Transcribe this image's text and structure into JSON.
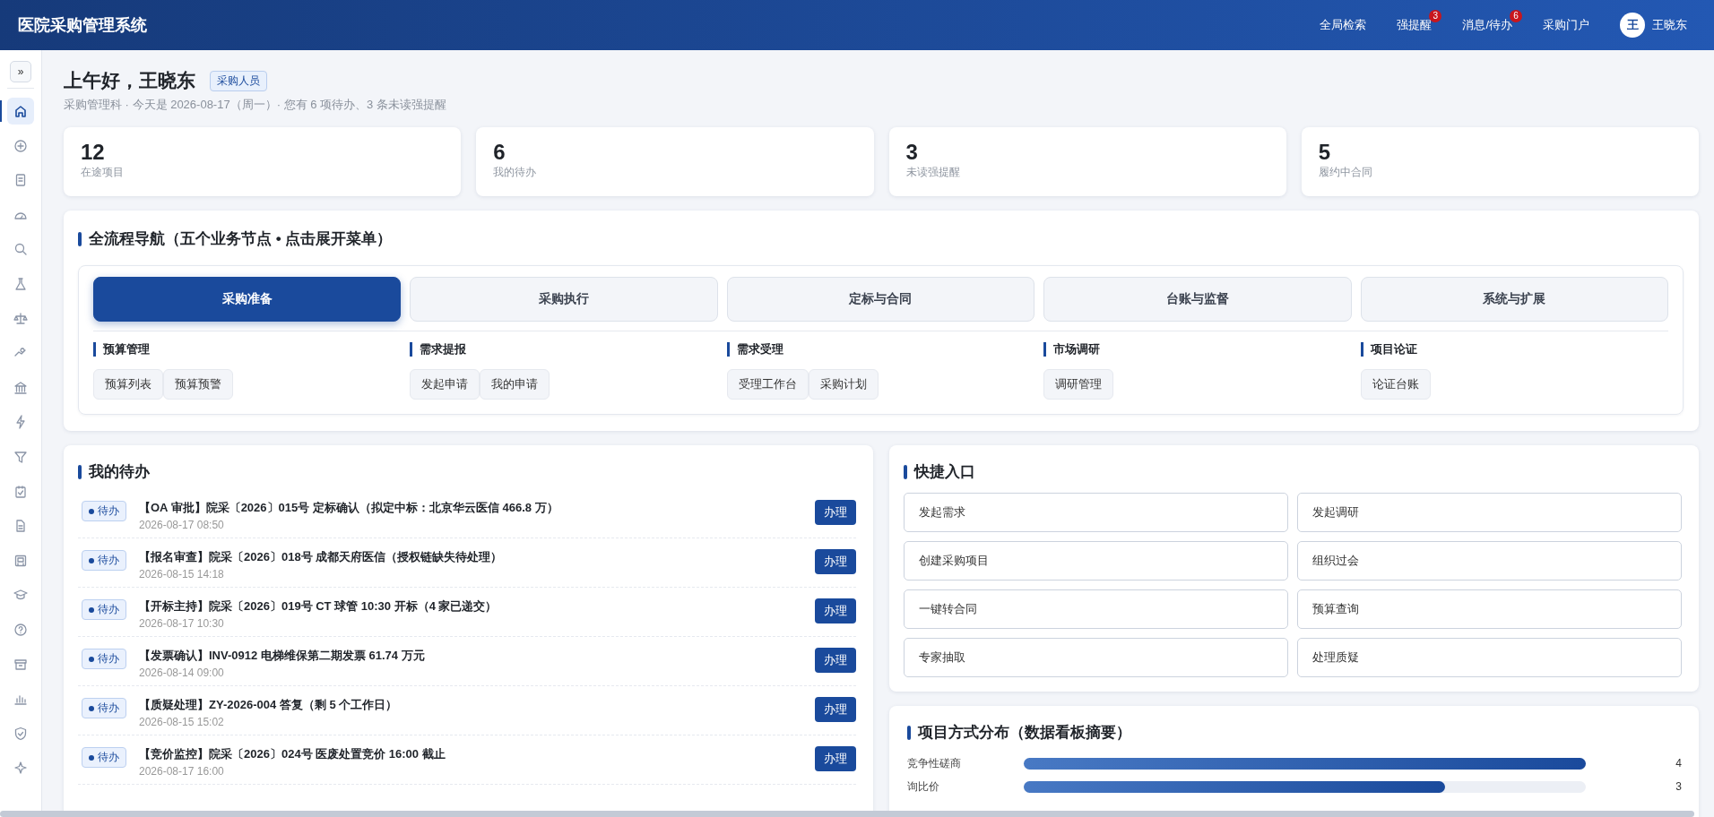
{
  "header": {
    "title": "医院采购管理系统",
    "links": [
      {
        "label": "全局检索"
      },
      {
        "label": "强提醒",
        "badge": "3"
      },
      {
        "label": "消息/待办",
        "badge": "6"
      },
      {
        "label": "采购门户"
      }
    ],
    "user": {
      "avatar": "王",
      "name": "王晓东"
    }
  },
  "sidebar": {
    "toggle": "»",
    "items": [
      {
        "selected": true
      },
      {
        "selected": false
      },
      {
        "selected": false
      },
      {
        "selected": false
      },
      {
        "selected": false
      },
      {
        "selected": false
      },
      {
        "selected": false
      },
      {
        "selected": false
      },
      {
        "selected": false
      },
      {
        "selected": false
      },
      {
        "selected": false
      },
      {
        "selected": false
      },
      {
        "selected": false
      },
      {
        "selected": false
      },
      {
        "selected": false
      },
      {
        "selected": false
      },
      {
        "selected": false
      },
      {
        "selected": false
      },
      {
        "selected": false
      },
      {
        "selected": false
      }
    ]
  },
  "greeting": {
    "title": "上午好，王晓东",
    "role": "采购人员",
    "subtitle": "采购管理科 · 今天是 2026-08-17（周一）· 您有 6 项待办、3 条未读强提醒"
  },
  "stats": [
    {
      "value": "12",
      "label": "在途项目"
    },
    {
      "value": "6",
      "label": "我的待办"
    },
    {
      "value": "3",
      "label": "未读强提醒"
    },
    {
      "value": "5",
      "label": "履约中合同"
    }
  ],
  "flow_nav": {
    "title": "全流程导航（五个业务节点 • 点击展开菜单）",
    "tabs": [
      {
        "label": "采购准备",
        "selected": true
      },
      {
        "label": "采购执行",
        "selected": false
      },
      {
        "label": "定标与合同",
        "selected": false
      },
      {
        "label": "台账与监督",
        "selected": false
      },
      {
        "label": "系统与扩展",
        "selected": false
      }
    ],
    "groups": [
      {
        "title": "预算管理",
        "items": [
          "预算列表",
          "预算预警"
        ]
      },
      {
        "title": "需求提报",
        "items": [
          "发起申请",
          "我的申请"
        ]
      },
      {
        "title": "需求受理",
        "items": [
          "受理工作台",
          "采购计划"
        ]
      },
      {
        "title": "市场调研",
        "items": [
          "调研管理"
        ]
      },
      {
        "title": "项目论证",
        "items": [
          "论证台账"
        ]
      }
    ]
  },
  "todo": {
    "title": "我的待办",
    "items": [
      {
        "status": "待办",
        "title": "【OA 审批】院采〔2026〕015号 定标确认（拟定中标：北京华云医信 466.8 万）",
        "time": "2026-08-17 08:50",
        "action": "办理"
      },
      {
        "status": "待办",
        "title": "【报名审查】院采〔2026〕018号 成都天府医信（授权链缺失待处理）",
        "time": "2026-08-15 14:18",
        "action": "办理"
      },
      {
        "status": "待办",
        "title": "【开标主持】院采〔2026〕019号 CT 球管 10:30 开标（4 家已递交）",
        "time": "2026-08-17 10:30",
        "action": "办理"
      },
      {
        "status": "待办",
        "title": "【发票确认】INV-0912 电梯维保第二期发票 61.74 万元",
        "time": "2026-08-14 09:00",
        "action": "办理"
      },
      {
        "status": "待办",
        "title": "【质疑处理】ZY-2026-004 答复（剩 5 个工作日）",
        "time": "2026-08-15 15:02",
        "action": "办理"
      },
      {
        "status": "待办",
        "title": "【竞价监控】院采〔2026〕024号 医废处置竞价 16:00 截止",
        "time": "2026-08-17 16:00",
        "action": "办理"
      }
    ]
  },
  "quick": {
    "title": "快捷入口",
    "items": [
      "发起需求",
      "发起调研",
      "创建采购项目",
      "组织过会",
      "一键转合同",
      "预算查询",
      "专家抽取",
      "处理质疑"
    ]
  },
  "distribution": {
    "title": "项目方式分布（数据看板摘要）",
    "rows": [
      {
        "label": "竞争性磋商",
        "level": 1,
        "value": "4"
      },
      {
        "label": "询比价",
        "level": 0.75,
        "value": "3"
      }
    ]
  }
}
